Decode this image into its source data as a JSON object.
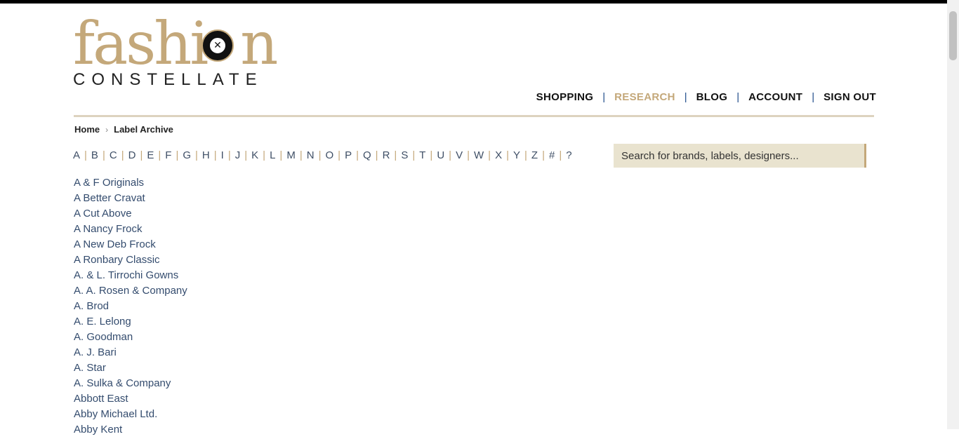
{
  "logo": {
    "main": "fashi",
    "main_end": "n",
    "sub": "CONSTELLATE"
  },
  "nav": [
    {
      "label": "SHOPPING",
      "active": false
    },
    {
      "label": "RESEARCH",
      "active": true
    },
    {
      "label": "BLOG",
      "active": false
    },
    {
      "label": "ACCOUNT",
      "active": false
    },
    {
      "label": "SIGN OUT",
      "active": false
    }
  ],
  "nav_separator": "|",
  "breadcrumb": {
    "home": "Home",
    "current": "Label Archive"
  },
  "alphabet": [
    "A",
    "B",
    "C",
    "D",
    "E",
    "F",
    "G",
    "H",
    "I",
    "J",
    "K",
    "L",
    "M",
    "N",
    "O",
    "P",
    "Q",
    "R",
    "S",
    "T",
    "U",
    "V",
    "W",
    "X",
    "Y",
    "Z",
    "#",
    "?"
  ],
  "search": {
    "placeholder": "Search for brands, labels, designers..."
  },
  "labels": [
    "A & F Originals",
    "A Better Cravat",
    "A Cut Above",
    "A Nancy Frock",
    "A New Deb Frock",
    "A Ronbary Classic",
    "A. & L. Tirrochi Gowns",
    "A. A. Rosen & Company",
    "A. Brod",
    "A. E. Lelong",
    "A. Goodman",
    "A. J. Bari",
    "A. Star",
    "A. Sulka & Company",
    "Abbott East",
    "Abby Michael Ltd.",
    "Abby Kent"
  ],
  "colors": {
    "accent": "#c4a87a",
    "link": "#344c6e",
    "search_bg": "#e9e3cf",
    "rule": "#ddd3bf"
  }
}
